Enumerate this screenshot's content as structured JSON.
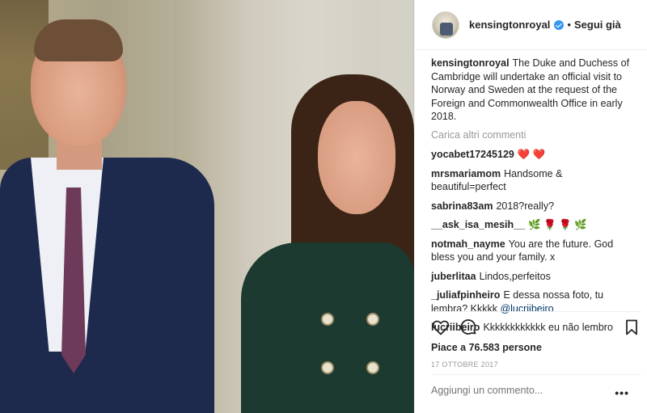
{
  "post": {
    "account": {
      "username": "kensingtonroyal",
      "verified": true,
      "follow_label": "Segui già",
      "separator": "•"
    },
    "caption": {
      "username": "kensingtonroyal",
      "text": "The Duke and Duchess of Cambridge will undertake an official visit to Norway and Sweden at the request of the Foreign and Commonwealth Office in early 2018."
    },
    "load_more_label": "Carica altri commenti",
    "comments": [
      {
        "username": "yocabet17245129",
        "text": "❤️ ❤️"
      },
      {
        "username": "mrsmariamom",
        "text": "Handsome & beautiful=perfect"
      },
      {
        "username": "sabrina83am",
        "text": "2018?really?"
      },
      {
        "username": "__ask_isa_mesih__",
        "text": "🌿 🌹 🌹 🌿"
      },
      {
        "username": "notmah_nayme",
        "text": "You are the future. God bless you and your family. x"
      },
      {
        "username": "juberlitaa",
        "text": "Lindos,perfeitos"
      },
      {
        "username": "_juliafpinheiro",
        "text": "E dessa nossa foto, tu lembra? Kkkkk ",
        "mention": "@lucriibeiro"
      },
      {
        "username": "lucriibeiro",
        "text": "Kkkkkkkkkkkk eu não lembro"
      }
    ],
    "likes_label": "Piace a 76.583 persone",
    "date": "17 OTTOBRE 2017",
    "add_comment_placeholder": "Aggiungi un commento...",
    "more_label": "•••",
    "icons": [
      "heart-icon",
      "comment-icon",
      "bookmark-icon",
      "more-icon",
      "verified-badge-icon"
    ],
    "colors": {
      "verified": "#3897f0",
      "muted": "#999999",
      "text": "#262626",
      "mention": "#003569"
    }
  }
}
